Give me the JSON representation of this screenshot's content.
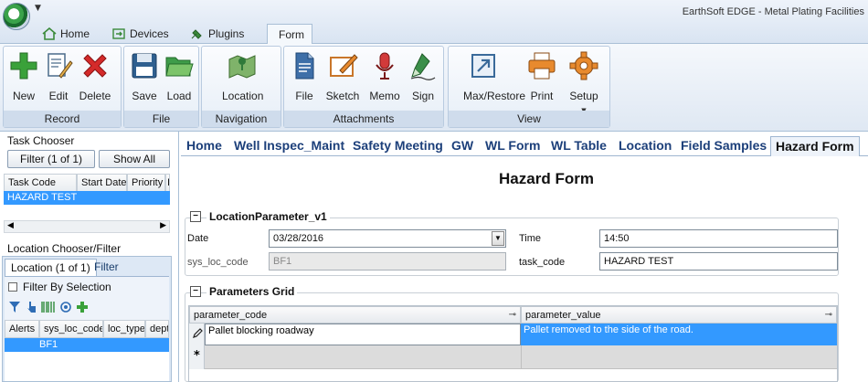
{
  "window": {
    "title": "EarthSoft EDGE - Metal Plating Facilities"
  },
  "qat": {
    "arrow": "▼"
  },
  "ribbon_tabs": [
    {
      "label": "Home"
    },
    {
      "label": "Devices"
    },
    {
      "label": "Plugins"
    },
    {
      "label": "Form"
    }
  ],
  "ribbon": {
    "groups": {
      "record": "Record",
      "file": "File",
      "navigation": "Navigation",
      "attachments": "Attachments",
      "view": "View"
    },
    "buttons": {
      "new": "New",
      "edit": "Edit",
      "delete": "Delete",
      "save": "Save",
      "load": "Load",
      "location": "Location",
      "file": "File",
      "sketch": "Sketch",
      "memo": "Memo",
      "sign": "Sign",
      "max_restore": "Max/Restore",
      "print": "Print",
      "setup": "Setup"
    },
    "setup_arrow": "▼"
  },
  "task_chooser": {
    "title": "Task Chooser",
    "filter_btn": "Filter (1 of 1)",
    "show_all_btn": "Show All",
    "columns": [
      "Task Code",
      "Start Date",
      "Priority",
      "I"
    ],
    "rows": [
      {
        "task_code": "HAZARD TEST"
      }
    ]
  },
  "location_chooser": {
    "title": "Location Chooser/Filter",
    "tabs": [
      "Location (1 of 1)",
      "Filter"
    ],
    "filter_by_selection": "Filter By Selection",
    "columns": [
      "Alerts",
      "sys_loc_code",
      "loc_type",
      "depth"
    ],
    "rows": [
      {
        "sys_loc_code": "BF1"
      }
    ]
  },
  "form_tabs": [
    "Home",
    "Well Inspec_Maint",
    "Safety Meeting",
    "GW",
    "WL Form",
    "WL Table",
    "Location",
    "Field Samples",
    "Hazard Form"
  ],
  "form": {
    "title": "Hazard Form",
    "location_section": {
      "title": "LocationParameter_v1",
      "date_label": "Date",
      "date_value": "03/28/2016",
      "time_label": "Time",
      "time_value": "14:50",
      "sys_loc_code_label": "sys_loc_code",
      "sys_loc_code_value": "BF1",
      "task_code_label": "task_code",
      "task_code_value": "HAZARD TEST"
    },
    "params_section": {
      "title": "Parameters Grid",
      "columns": [
        "parameter_code",
        "parameter_value"
      ],
      "rows": [
        {
          "parameter_code": "Pallet blocking roadway",
          "parameter_value": "Pallet removed to the side of the road."
        }
      ],
      "new_row_marker": "*"
    }
  },
  "colors": {
    "selection": "#3399ff",
    "ribbon_label_bg": "#cfdcec",
    "tab_text": "#1c3f7a"
  }
}
